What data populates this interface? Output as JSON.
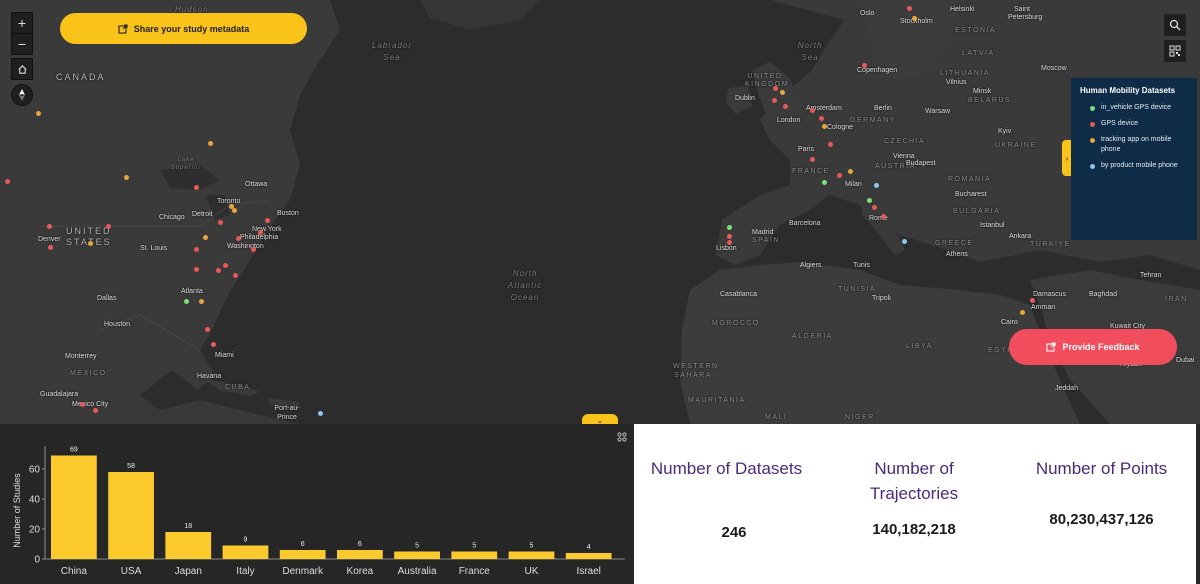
{
  "header": {
    "share_label": "Share your study metadata"
  },
  "feedback_label": "Provide Feedback",
  "map": {
    "controls": [
      "+",
      "−"
    ],
    "labels": {
      "hudson": "Hudson",
      "labrador_sea": "Labrador Sea",
      "canada": "CANADA",
      "lake_superior": "Lake Superior",
      "ottawa": "Ottawa",
      "toronto": "Toronto",
      "detroit": "Detroit",
      "chicago": "Chicago",
      "boston": "Boston",
      "new_york": "New York",
      "philadelphia": "Philadelphia",
      "washington": "Washington",
      "denver": "Denver",
      "united_states": "UNITED STATES",
      "st_louis": "St. Louis",
      "atlanta": "Atlanta",
      "dallas": "Dallas",
      "houston": "Houston",
      "miami": "Miami",
      "havana": "Havana",
      "cuba": "CUBA",
      "monterrey": "Monterrey",
      "mexico": "MEXICO",
      "guadalajara": "Guadalajara",
      "mexico_city": "Mexico City",
      "port_au_prince": "Port-au-Prince",
      "north_atlantic": "North Atlantic Ocean",
      "north_sea": "North Sea",
      "oslo": "Oslo",
      "stockholm": "Stockholm",
      "helsinki": "Helsinki",
      "saint_petersburg": "Saint Petersburg",
      "estonia": "ESTONIA",
      "latvia": "LATVIA",
      "lithuania": "LITHUANIA",
      "vilnius": "Vilnius",
      "minsk": "Minsk",
      "belarus": "BELARUS",
      "moscow": "Moscow",
      "copenhagen": "Copenhagen",
      "united_kingdom": "UNITED KINGDOM",
      "dublin": "Dublin",
      "london": "London",
      "amsterdam": "Amsterdam",
      "berlin": "Berlin",
      "warsaw": "Warsaw",
      "germany": "GERMANY",
      "cologne": "Cologne",
      "kyiv": "Kyiv",
      "ukraine": "UKRAINE",
      "paris": "Paris",
      "czechia": "CZECHIA",
      "austria": "AUSTRIA",
      "vienna": "Vienna",
      "budapest": "Budapest",
      "france": "FRANCE",
      "romania": "ROMANIA",
      "milan": "Milan",
      "bucharest": "Bucharest",
      "bulgaria": "BULGARIA",
      "rome": "Rome",
      "madrid": "Madrid",
      "spain": "SPAIN",
      "barcelona": "Barcelona",
      "lisbon": "Lisbon",
      "istanbul": "Istanbul",
      "ankara": "Ankara",
      "turkiye": "TÜRKIYE",
      "greece": "GREECE",
      "athens": "Athens",
      "algiers": "Algiers",
      "tunis": "Tunis",
      "tunisia": "TUNISIA",
      "tripoli": "Tripoli",
      "casablanca": "Casablanca",
      "morocco": "MOROCCO",
      "algeria": "ALGERIA",
      "libya": "LIBYA",
      "egypt": "EGYPT",
      "cairo": "Cairo",
      "damascus": "Damascus",
      "amman": "Amman",
      "baghdad": "Baghdad",
      "tehran": "Tehran",
      "iran": "IRAN",
      "kuwait_city": "Kuwait City",
      "riyadh": "Riyadh",
      "dubai": "Dubai",
      "jeddah": "Jeddah",
      "western_sahara": "WESTERN SAHARA",
      "mauritania": "MAURITANIA",
      "mali": "MALI",
      "niger": "NIGER"
    }
  },
  "legend": {
    "title": "Human Mobility Datasets",
    "items": [
      {
        "label": "in_vehicle GPS device",
        "color": "#7be07b"
      },
      {
        "label": "GPS device",
        "color": "#e85a5a"
      },
      {
        "label": "tracking app on mobile phone",
        "color": "#e6a83c"
      },
      {
        "label": "by product mobile phone",
        "color": "#8cc8f0"
      }
    ]
  },
  "chart_data": {
    "type": "bar",
    "categories": [
      "China",
      "USA",
      "Japan",
      "Italy",
      "Denmark",
      "Korea",
      "Australia",
      "France",
      "UK",
      "Israel"
    ],
    "values": [
      69,
      58,
      18,
      9,
      6,
      6,
      5,
      5,
      5,
      4
    ],
    "ylabel": "Number of Studies",
    "ylim": [
      0,
      70
    ],
    "yticks": [
      0,
      20,
      40,
      60
    ],
    "bar_color": "#fdca2e"
  },
  "stats": {
    "datasets_label": "Number of Datasets",
    "datasets_value": "246",
    "trajectories_label": "Number of Trajectories",
    "trajectories_value": "140,182,218",
    "points_label": "Number of Points",
    "points_value": "80,230,437,126"
  }
}
